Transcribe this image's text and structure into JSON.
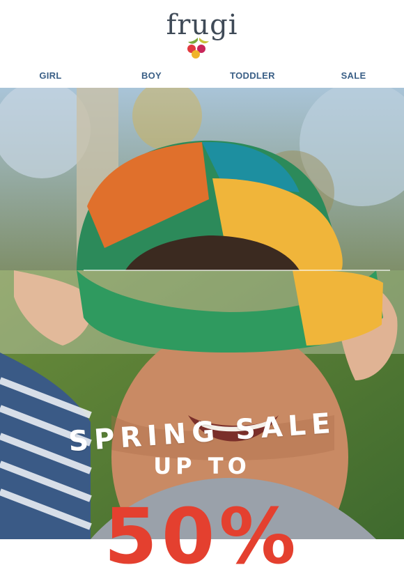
{
  "brand": {
    "name": "frugi",
    "icon": "berries-logo"
  },
  "nav": {
    "items": [
      {
        "label": "GIRL"
      },
      {
        "label": "BOY"
      },
      {
        "label": "TODDLER"
      },
      {
        "label": "SALE"
      }
    ]
  },
  "hero": {
    "line1": "SPRING SALE",
    "line2": "UP TO",
    "big_text": "50%",
    "colors": {
      "text": "#ffffff",
      "accent": "#e4402f",
      "nav": "#3a5f86",
      "logo": "#3f4a57"
    }
  }
}
